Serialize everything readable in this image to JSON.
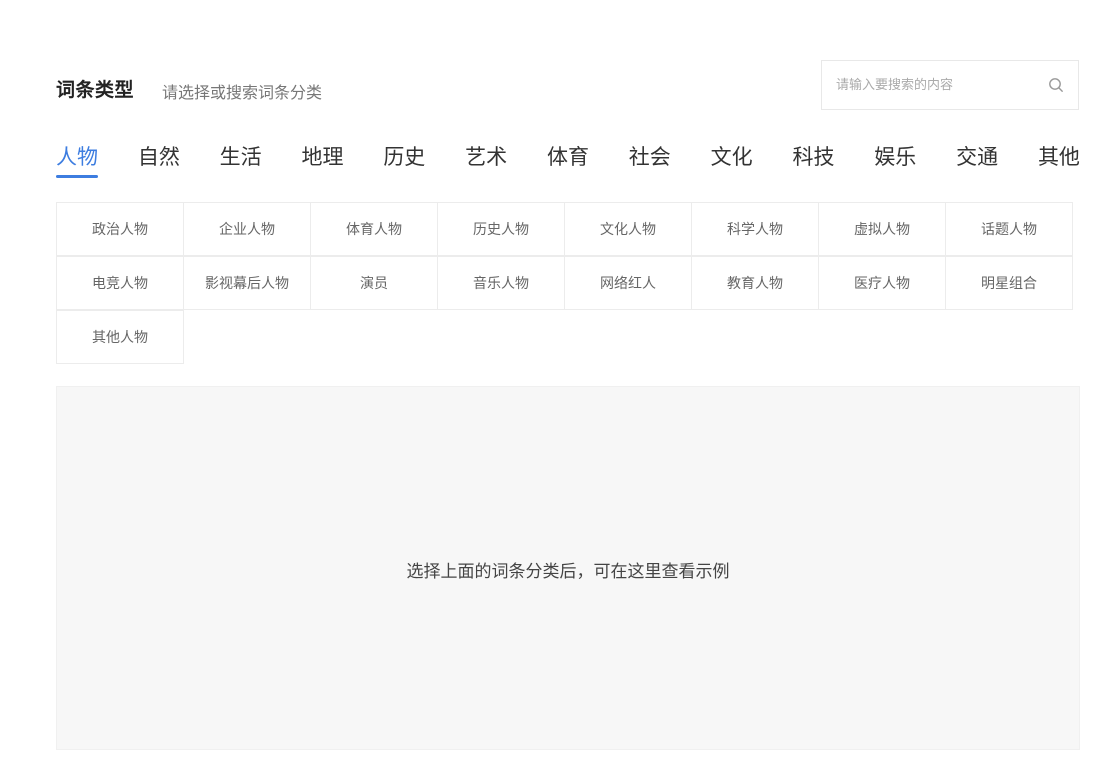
{
  "header": {
    "title": "词条类型",
    "subtitle": "请选择或搜索词条分类",
    "search": {
      "placeholder": "请输入要搜索的内容",
      "value": "",
      "icon": "search-icon"
    }
  },
  "tabs": [
    {
      "label": "人物",
      "active": true
    },
    {
      "label": "自然",
      "active": false
    },
    {
      "label": "生活",
      "active": false
    },
    {
      "label": "地理",
      "active": false
    },
    {
      "label": "历史",
      "active": false
    },
    {
      "label": "艺术",
      "active": false
    },
    {
      "label": "体育",
      "active": false
    },
    {
      "label": "社会",
      "active": false
    },
    {
      "label": "文化",
      "active": false
    },
    {
      "label": "科技",
      "active": false
    },
    {
      "label": "娱乐",
      "active": false
    },
    {
      "label": "交通",
      "active": false
    },
    {
      "label": "其他",
      "active": false
    }
  ],
  "subcategories": [
    "政治人物",
    "企业人物",
    "体育人物",
    "历史人物",
    "文化人物",
    "科学人物",
    "虚拟人物",
    "话题人物",
    "电竞人物",
    "影视幕后人物",
    "演员",
    "音乐人物",
    "网络红人",
    "教育人物",
    "医疗人物",
    "明星组合",
    "其他人物"
  ],
  "example_panel": {
    "hint": "选择上面的词条分类后，可在这里查看示例"
  },
  "colors": {
    "accent": "#3d7de0",
    "panel_bg": "#f7f7f7",
    "border": "#ececec"
  }
}
